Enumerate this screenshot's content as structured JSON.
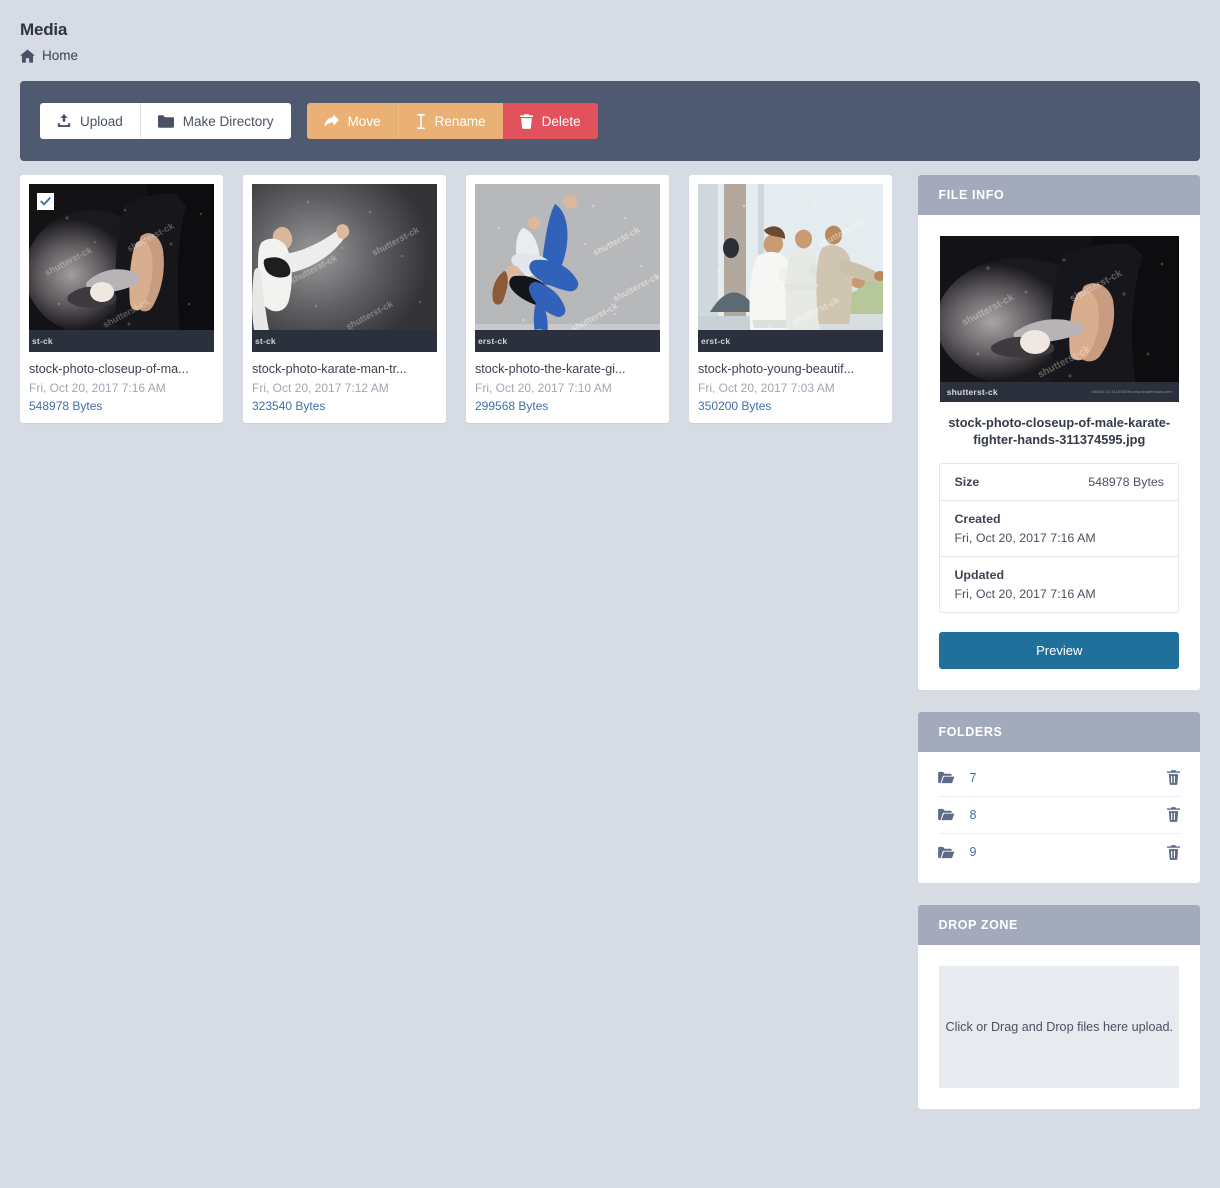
{
  "header": {
    "title": "Media",
    "breadcrumb_home": "Home",
    "home_icon": "home-icon"
  },
  "toolbar": {
    "upload_label": "Upload",
    "upload_icon": "upload-icon",
    "make_directory_label": "Make Directory",
    "make_directory_icon": "folder-icon",
    "move_label": "Move",
    "move_icon": "arrow-share-icon",
    "rename_label": "Rename",
    "rename_icon": "text-cursor-icon",
    "delete_label": "Delete",
    "delete_icon": "trash-icon",
    "colors": {
      "bar": "#4f5970",
      "light_button": "#ffffff",
      "warn_button": "#e9b274",
      "danger_button": "#e2525c"
    }
  },
  "files": [
    {
      "name": "stock-photo-closeup-of-ma...",
      "date": "Fri, Oct 20, 2017 7:16 AM",
      "size": "548978 Bytes",
      "selected": true,
      "watermark": "st-ck",
      "thumb": "karate-hands-dark"
    },
    {
      "name": "stock-photo-karate-man-tr...",
      "date": "Fri, Oct 20, 2017 7:12 AM",
      "size": "323540 Bytes",
      "selected": false,
      "watermark": "st-ck",
      "thumb": "karate-man-kick"
    },
    {
      "name": "stock-photo-the-karate-gi...",
      "date": "Fri, Oct 20, 2017 7:10 AM",
      "size": "299568 Bytes",
      "selected": false,
      "watermark": "erst-ck",
      "thumb": "karate-girl-blue"
    },
    {
      "name": "stock-photo-young-beautif...",
      "date": "Fri, Oct 20, 2017 7:03 AM",
      "size": "350200 Bytes",
      "selected": false,
      "watermark": "erst-ck",
      "thumb": "karate-kids-class"
    }
  ],
  "file_info": {
    "panel_title": "FILE INFO",
    "preview_watermark": "shutterst-ck",
    "preview_code": "IMAGE ID 311374595\nwww.shutterstock.com",
    "filename": "stock-photo-closeup-of-male-karate-fighter-hands-311374595.jpg",
    "rows": [
      {
        "key": "Size",
        "value": "548978 Bytes",
        "layout": "inline"
      },
      {
        "key": "Created",
        "value": "Fri, Oct 20, 2017 7:16 AM",
        "layout": "stacked"
      },
      {
        "key": "Updated",
        "value": "Fri, Oct 20, 2017 7:16 AM",
        "layout": "stacked"
      }
    ],
    "preview_button": "Preview",
    "preview_button_color": "#21709c"
  },
  "folders": {
    "panel_title": "FOLDERS",
    "items": [
      {
        "name": "7",
        "folder_icon": "open-folder-icon",
        "delete_icon": "trash-icon"
      },
      {
        "name": "8",
        "folder_icon": "open-folder-icon",
        "delete_icon": "trash-icon"
      },
      {
        "name": "9",
        "folder_icon": "open-folder-icon",
        "delete_icon": "trash-icon"
      }
    ]
  },
  "drop_zone": {
    "panel_title": "DROP ZONE",
    "message": "Click or Drag and Drop files here upload."
  },
  "theme": {
    "background": "#d7dbe3",
    "panel_header": "#a2aabc",
    "link": "#3f6fa8",
    "muted_text": "#a0a6b2"
  }
}
